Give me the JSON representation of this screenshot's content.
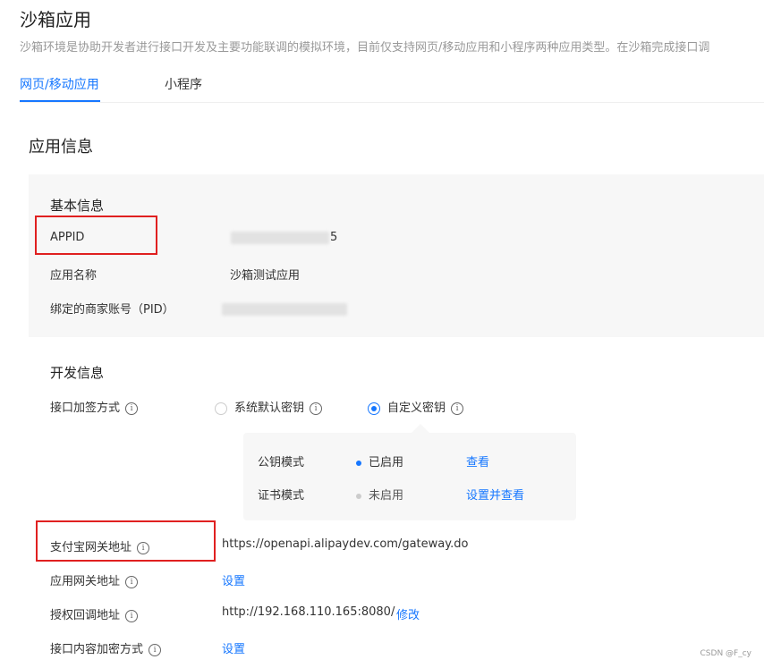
{
  "page": {
    "title": "沙箱应用",
    "description": "沙箱环境是协助开发者进行接口开发及主要功能联调的模拟环境，目前仅支持网页/移动应用和小程序两种应用类型。在沙箱完成接口调"
  },
  "tabs": {
    "web_mobile": "网页/移动应用",
    "mini_program": "小程序"
  },
  "app_info": {
    "title": "应用信息",
    "basic": {
      "title": "基本信息",
      "appid_label": "APPID",
      "appid_value_visible_suffix": "5",
      "name_label": "应用名称",
      "name_value": "沙箱测试应用",
      "pid_label": "绑定的商家账号（PID）"
    },
    "dev": {
      "title": "开发信息",
      "sign_label": "接口加签方式",
      "radio_default": "系统默认密钥",
      "radio_custom": "自定义密钥",
      "popover": {
        "row1_label": "公钥模式",
        "row1_status": "已启用",
        "row1_action": "查看",
        "row2_label": "证书模式",
        "row2_status": "未启用",
        "row2_action": "设置并查看"
      },
      "gateway_label": "支付宝网关地址",
      "gateway_value": "https://openapi.alipaydev.com/gateway.do",
      "app_gateway_label": "应用网关地址",
      "app_gateway_action": "设置",
      "callback_label": "授权回调地址",
      "callback_value": "http://192.168.110.165:8080/",
      "callback_action": "修改",
      "encrypt_label": "接口内容加密方式",
      "encrypt_action": "设置"
    }
  },
  "icons": {
    "info": "info-icon"
  },
  "colors": {
    "accent": "#1677ff",
    "highlight_box": "#e02020",
    "disabled_dot": "#cccccc"
  },
  "watermark": "CSDN @F_cy"
}
